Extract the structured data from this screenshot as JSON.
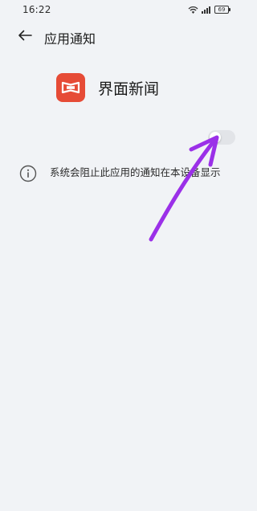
{
  "status_bar": {
    "time": "16:22",
    "battery": "69",
    "icons": [
      "wifi-icon",
      "signal-icon",
      "battery-icon"
    ]
  },
  "header": {
    "back_icon": "back-arrow-icon",
    "title": "应用通知"
  },
  "app": {
    "name": "界面新闻",
    "icon": "app-logo-icon",
    "icon_color": "#e64b36"
  },
  "notification_toggle": {
    "enabled": false
  },
  "info": {
    "icon": "info-icon",
    "text": "系统会阻止此应用的通知在本设备显示"
  },
  "annotation": {
    "color": "#9b30e8"
  }
}
